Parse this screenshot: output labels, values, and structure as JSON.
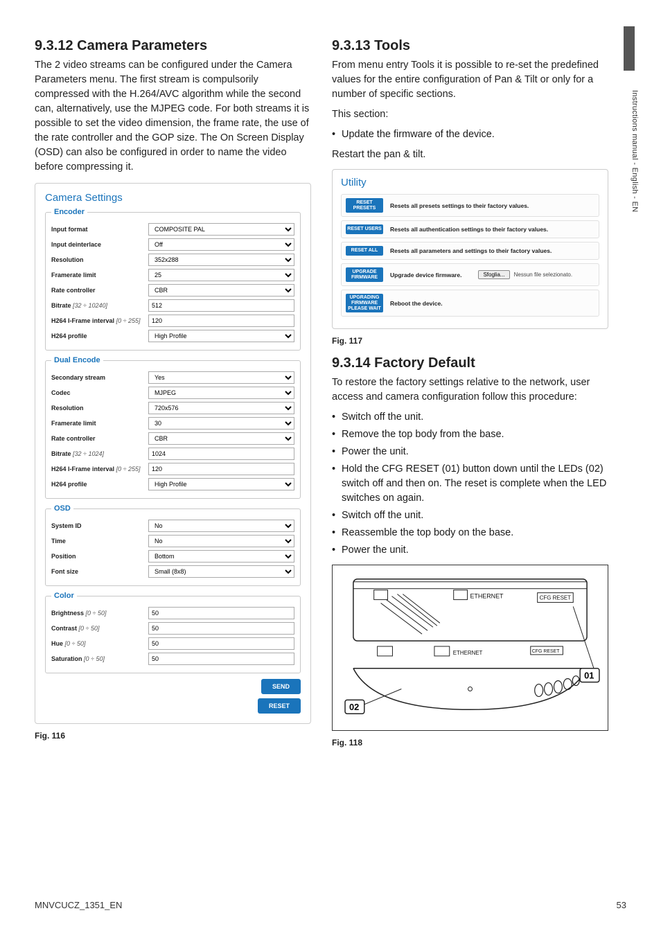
{
  "side": {
    "vertical_text": "Instructions manual - English - EN"
  },
  "footer": {
    "doc_code": "MNVCUCZ_1351_EN",
    "page_number": "53"
  },
  "left": {
    "heading": "9.3.12 Camera Parameters",
    "paragraph": "The 2 video streams can be configured under the Camera Parameters menu. The first stream is compulsorily compressed with the H.264/AVC algorithm while the second can, alternatively, use the MJPEG code. For both streams it is possible to set the video dimension, the frame rate, the use of the rate controller and the GOP size. The On Screen Display (OSD) can also be configured in order to name the video before compressing it.",
    "panel_title": "Camera Settings",
    "groups": {
      "encoder": {
        "legend": "Encoder",
        "input_format": {
          "label": "Input format",
          "value": "COMPOSITE PAL"
        },
        "input_deinterlace": {
          "label": "Input deinterlace",
          "value": "Off"
        },
        "resolution": {
          "label": "Resolution",
          "value": "352x288"
        },
        "framerate_limit": {
          "label": "Framerate limit",
          "value": "25"
        },
        "rate_controller": {
          "label": "Rate controller",
          "value": "CBR"
        },
        "bitrate": {
          "label": "Bitrate",
          "range": "[32 ÷ 10240]",
          "value": "512"
        },
        "iframe": {
          "label": "H264 I-Frame interval",
          "range": "[0 ÷ 255]",
          "value": "120"
        },
        "profile": {
          "label": "H264 profile",
          "value": "High Profile"
        }
      },
      "dual": {
        "legend": "Dual Encode",
        "secondary": {
          "label": "Secondary stream",
          "value": "Yes"
        },
        "codec": {
          "label": "Codec",
          "value": "MJPEG"
        },
        "resolution": {
          "label": "Resolution",
          "value": "720x576"
        },
        "framerate_limit": {
          "label": "Framerate limit",
          "value": "30"
        },
        "rate_controller": {
          "label": "Rate controller",
          "value": "CBR"
        },
        "bitrate": {
          "label": "Bitrate",
          "range": "[32 ÷ 1024]",
          "value": "1024"
        },
        "iframe": {
          "label": "H264 I-Frame interval",
          "range": "[0 ÷ 255]",
          "value": "120"
        },
        "profile": {
          "label": "H264 profile",
          "value": "High Profile"
        }
      },
      "osd": {
        "legend": "OSD",
        "system_id": {
          "label": "System ID",
          "value": "No"
        },
        "time": {
          "label": "Time",
          "value": "No"
        },
        "position": {
          "label": "Position",
          "value": "Bottom"
        },
        "font_size": {
          "label": "Font size",
          "value": "Small (8x8)"
        }
      },
      "color": {
        "legend": "Color",
        "brightness": {
          "label": "Brightness",
          "range": "[0 ÷ 50]",
          "value": "50"
        },
        "contrast": {
          "label": "Contrast",
          "range": "[0 ÷ 50]",
          "value": "50"
        },
        "hue": {
          "label": "Hue",
          "range": "[0 ÷ 50]",
          "value": "50"
        },
        "saturation": {
          "label": "Saturation",
          "range": "[0 ÷ 50]",
          "value": "50"
        }
      }
    },
    "send_label": "SEND",
    "reset_label": "RESET",
    "fig_caption": "Fig. 116"
  },
  "right": {
    "tools": {
      "heading": "9.3.13 Tools",
      "para1": "From menu entry Tools  it is possible to re-set the predefined values for the entire configuration of Pan & Tilt or only for a number of specific sections.",
      "para2": "This section:",
      "bullet1": "Update the firmware of the device.",
      "para3": "Restart the pan & tilt."
    },
    "utility": {
      "title": "Utility",
      "reset_presets": {
        "btn": "RESET PRESETS",
        "desc": "Resets all presets settings to their factory values."
      },
      "reset_users": {
        "btn": "RESET USERS",
        "desc": "Resets all authentication settings to their factory values."
      },
      "reset_all": {
        "btn": "RESET ALL",
        "desc": "Resets all parameters and settings to their factory values."
      },
      "upgrade": {
        "btn": "UPGRADE FIRMWARE",
        "desc": "Upgrade device firmware.",
        "browse": "Sfoglia...",
        "nofile": "Nessun file selezionato."
      },
      "upgrading": {
        "btn": "UPGRADING FIRMWARE PLEASE WAIT",
        "desc": "Reboot the device."
      }
    },
    "fig117": "Fig. 117",
    "factory": {
      "heading": "9.3.14 Factory Default",
      "para": "To restore the factory settings relative to the network, user access and camera configuration follow this procedure:",
      "bullets": [
        "Switch off the unit.",
        "Remove the top body from the base.",
        "Power the unit.",
        "Hold the CFG RESET (01) button down until the LEDs (02) switch off and then on. The reset is complete when the LED switches on again.",
        "Switch off the unit.",
        "Reassemble the top body on the base.",
        "Power the unit."
      ]
    },
    "diagram": {
      "ethernet1": "ETHERNET",
      "ethernet2": "ETHERNET",
      "cfg1": "CFG RESET",
      "cfg2": "CFG RESET",
      "callout01": "01",
      "callout02": "02"
    },
    "fig118": "Fig. 118"
  }
}
